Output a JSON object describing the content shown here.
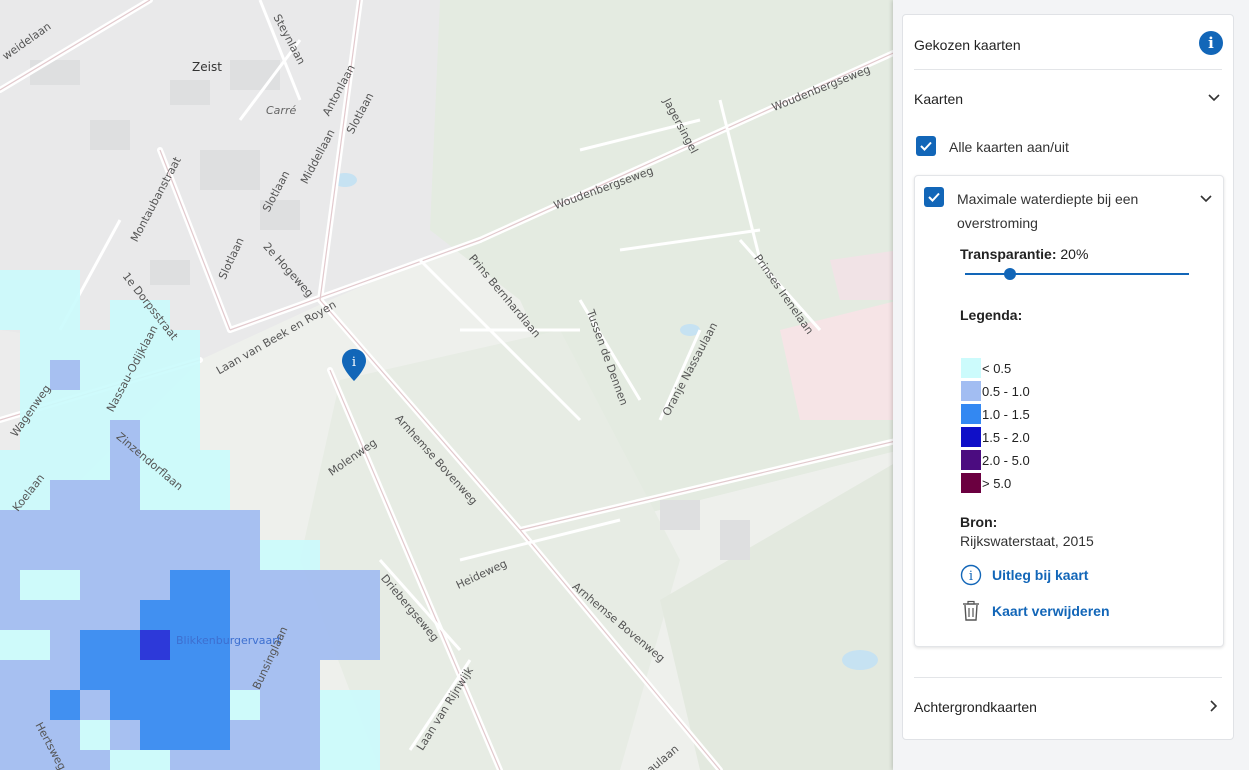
{
  "map": {
    "streets": [
      {
        "text": "Steynlaan"
      },
      {
        "text": "weidelaan"
      },
      {
        "text": "Zeist"
      },
      {
        "text": "Antonlaan"
      },
      {
        "text": "Carré"
      },
      {
        "text": "Slotlaan"
      },
      {
        "text": "Middellaan"
      },
      {
        "text": "Montaubanstraat"
      },
      {
        "text": "Slotlaan"
      },
      {
        "text": "Slotlaan"
      },
      {
        "text": "2e Hogeweg"
      },
      {
        "text": "1e Dorpsstraat"
      },
      {
        "text": "Laan van Beek en Royen"
      },
      {
        "text": "Nassau-Odijklaan"
      },
      {
        "text": "Wagenweg"
      },
      {
        "text": "Zinzendorflaan"
      },
      {
        "text": "Koelaan"
      },
      {
        "text": "Molenweg"
      },
      {
        "text": "Arnhemse Bovenweg"
      },
      {
        "text": "Prins Bernhardlaan"
      },
      {
        "text": "Woudenbergseweg"
      },
      {
        "text": "Woudenbergseweg"
      },
      {
        "text": "Jagersingel"
      },
      {
        "text": "Tussen de Dennen"
      },
      {
        "text": "Oranje Nassaulaan"
      },
      {
        "text": "Prinses Irenelaan"
      },
      {
        "text": "Heideweg"
      },
      {
        "text": "Driebergseweg"
      },
      {
        "text": "Arnhemse Bovenweg"
      },
      {
        "text": "Laan van Rijnwijk"
      },
      {
        "text": "Blikkenburgervaart"
      },
      {
        "text": "Bunsinglaan"
      },
      {
        "text": "Hertsweg"
      },
      {
        "text": "saulaan"
      }
    ]
  },
  "panel": {
    "title": "Gekozen kaarten",
    "info_icon": "info-icon",
    "kaarten_label": "Kaarten",
    "all_toggle_label": "Alle kaarten aan/uit",
    "layer": {
      "title": "Maximale waterdiepte bij een overstroming",
      "transparency_label": "Transparantie:",
      "transparency_value": "20%",
      "transparency_fraction": 0.2,
      "legend_title": "Legenda:",
      "legend": [
        {
          "label": "< 0.5",
          "color": "#ccfbfc"
        },
        {
          "label": "0.5 - 1.0",
          "color": "#a2bdf2"
        },
        {
          "label": "1.0 - 1.5",
          "color": "#3388f2"
        },
        {
          "label": "1.5 - 2.0",
          "color": "#0f0fc8"
        },
        {
          "label": "2.0 - 5.0",
          "color": "#4b0c80"
        },
        {
          "label": "> 5.0",
          "color": "#6b0040"
        }
      ],
      "source_title": "Bron:",
      "source_value": "Rijkswaterstaat, 2015",
      "explain_label": "Uitleg bij kaart",
      "remove_label": "Kaart verwijderen"
    },
    "background_label": "Achtergrondkaarten"
  },
  "colors": {
    "accent": "#1266b8",
    "flood_light": "#ccfbfc",
    "flood_mid": "#a2bdf2",
    "flood_strong": "#3388f2",
    "flood_deep": "#0f0fc8"
  }
}
